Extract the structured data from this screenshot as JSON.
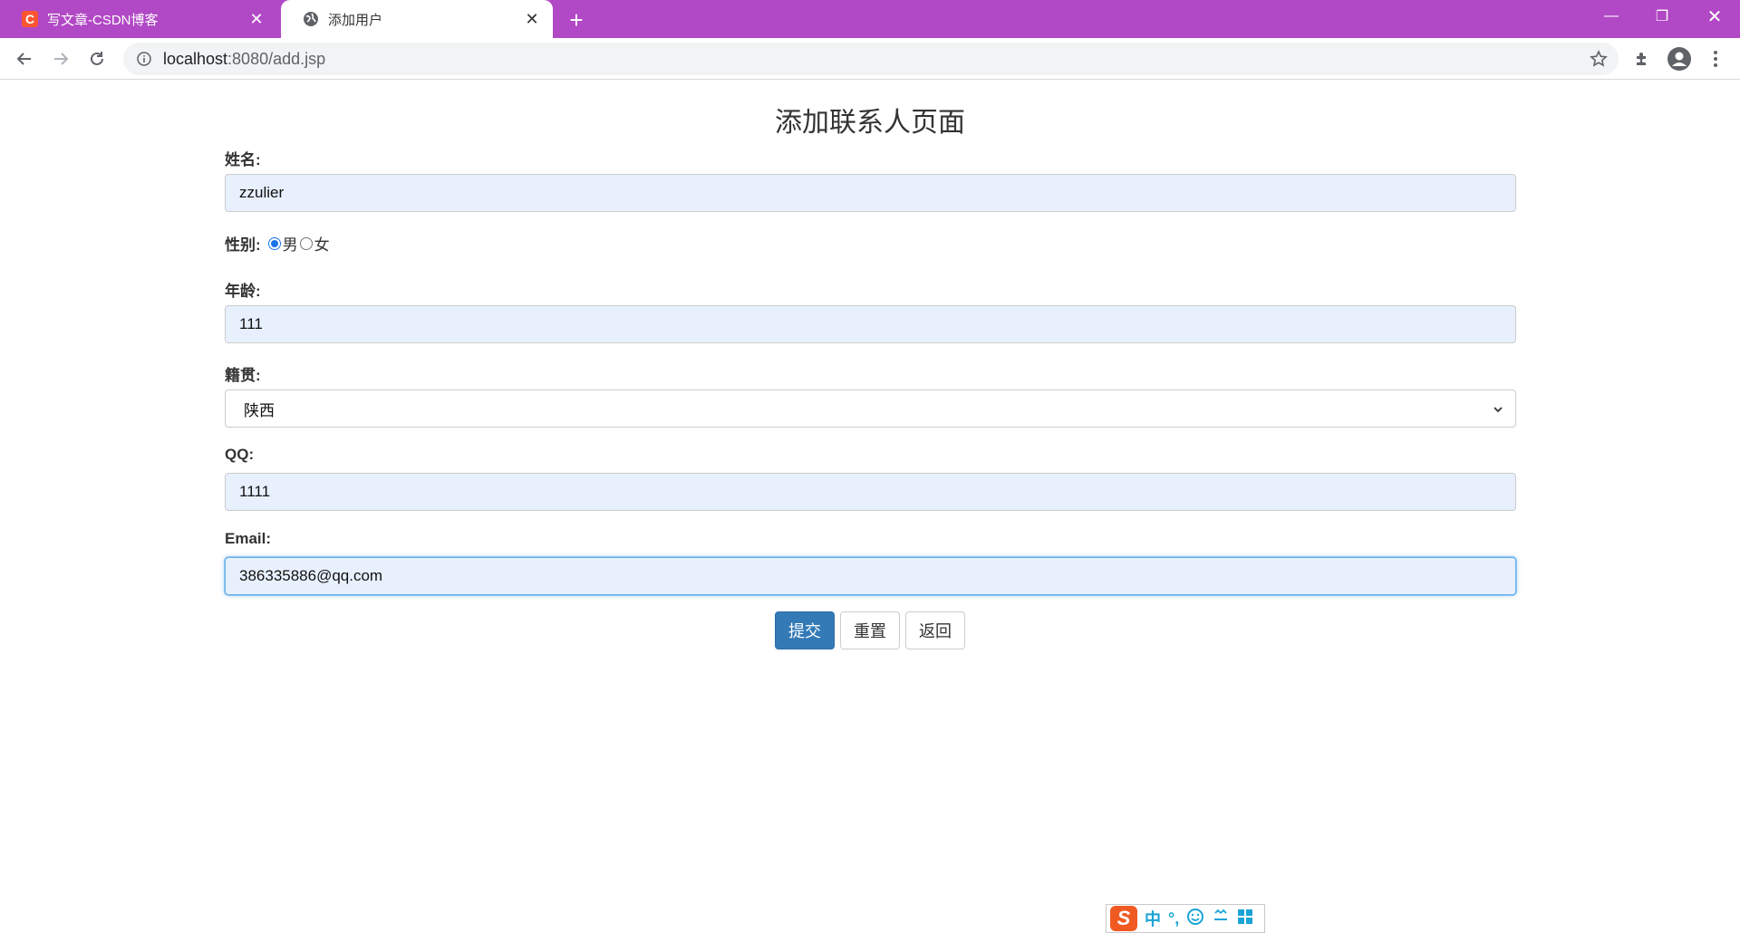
{
  "browser": {
    "tabs": [
      {
        "title": "写文章-CSDN博客",
        "favicon": "csdn-icon",
        "active": false
      },
      {
        "title": "添加用户",
        "favicon": "globe-icon",
        "active": true
      }
    ],
    "new_tab": "+",
    "url_host": "localhost",
    "url_path": ":8080/add.jsp",
    "accent_color": "#b148c5"
  },
  "page": {
    "title": "添加联系人页面",
    "name": {
      "label": "姓名:",
      "value": "zzulier"
    },
    "gender": {
      "label": "性别:",
      "options": [
        "男",
        "女"
      ],
      "selected": "男"
    },
    "age": {
      "label": "年龄:",
      "value": "111"
    },
    "hometown": {
      "label": "籍贯:",
      "value": "陕西"
    },
    "qq": {
      "label": "QQ:",
      "value": "1111"
    },
    "email": {
      "label": "Email:",
      "value": "386335886@qq.com"
    },
    "buttons": {
      "submit": "提交",
      "reset": "重置",
      "back": "返回"
    },
    "primary_color": "#337ab7"
  },
  "ime": {
    "mode": "中",
    "punct": "°,",
    "logo": "S"
  }
}
